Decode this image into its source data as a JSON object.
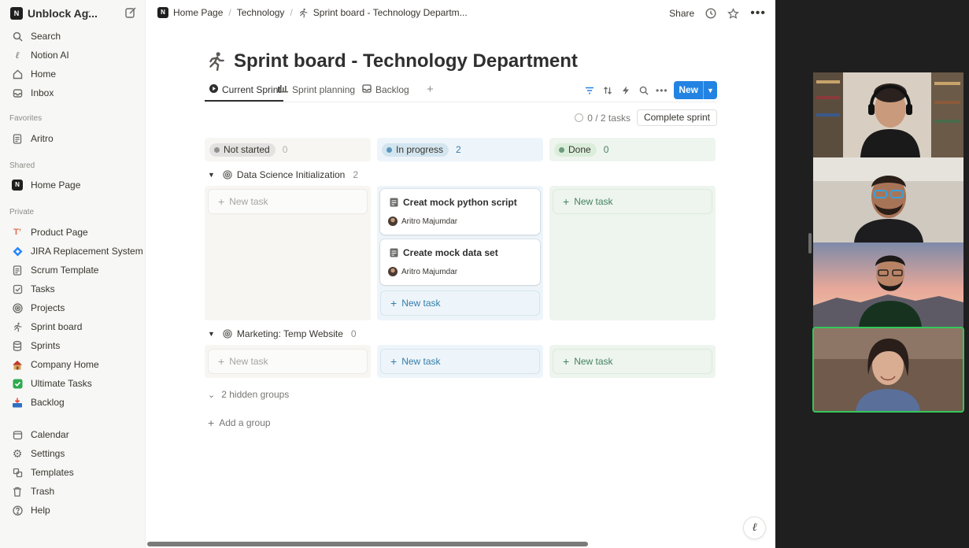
{
  "sidebar": {
    "workspace_name": "Unblock Ag...",
    "top_items": [
      {
        "label": "Search",
        "icon": "search-icon"
      },
      {
        "label": "Notion AI",
        "icon": "notion-ai-icon"
      },
      {
        "label": "Home",
        "icon": "home-icon"
      },
      {
        "label": "Inbox",
        "icon": "inbox-icon"
      }
    ],
    "favorites_label": "Favorites",
    "favorites": [
      {
        "label": "Aritro",
        "icon": "page-icon"
      }
    ],
    "shared_label": "Shared",
    "shared": [
      {
        "label": "Home Page",
        "icon": "notion-logo-icon"
      }
    ],
    "private_label": "Private",
    "private": [
      {
        "label": "Product Page",
        "icon": "product-page-icon"
      },
      {
        "label": "JIRA Replacement System",
        "icon": "jira-icon"
      },
      {
        "label": "Scrum Template",
        "icon": "page-icon"
      },
      {
        "label": "Tasks",
        "icon": "checkbox-icon"
      },
      {
        "label": "Projects",
        "icon": "target-icon"
      },
      {
        "label": "Sprint board",
        "icon": "runner-icon"
      },
      {
        "label": "Sprints",
        "icon": "database-icon"
      },
      {
        "label": "Company Home",
        "icon": "house-emoji-icon"
      },
      {
        "label": "Ultimate Tasks",
        "icon": "green-check-icon"
      },
      {
        "label": "Backlog",
        "icon": "inbox-tray-icon"
      }
    ],
    "bottom_items": [
      {
        "label": "Calendar",
        "icon": "calendar-icon"
      },
      {
        "label": "Settings",
        "icon": "gear-icon"
      },
      {
        "label": "Templates",
        "icon": "templates-icon"
      },
      {
        "label": "Trash",
        "icon": "trash-icon"
      },
      {
        "label": "Help",
        "icon": "help-icon"
      }
    ]
  },
  "topbar": {
    "breadcrumbs": [
      "Home Page",
      "Technology",
      "Sprint board - Technology Departm..."
    ],
    "share_label": "Share"
  },
  "page": {
    "title": "Sprint board - Technology Department",
    "tabs": [
      {
        "label": "Current Sprint",
        "icon": "play-icon"
      },
      {
        "label": "Sprint planning",
        "icon": "timeline-icon"
      },
      {
        "label": "Backlog",
        "icon": "inbox-tray-icon"
      }
    ],
    "new_label": "New",
    "progress_text": "0 / 2 tasks",
    "complete_sprint_label": "Complete sprint",
    "columns": [
      {
        "label": "Not started",
        "count": "0",
        "pill_bg": "#e3e2e0",
        "dot": "#91918e",
        "head_bg": "#f7f6f3",
        "count_color": "#b4b3af"
      },
      {
        "label": "In progress",
        "count": "2",
        "pill_bg": "#d3e5ef",
        "dot": "#5b97bd",
        "head_bg": "#eef5fa",
        "count_color": "#337ea9"
      },
      {
        "label": "Done",
        "count": "0",
        "pill_bg": "#dbeddb",
        "dot": "#6c9b7d",
        "head_bg": "#eef4ee",
        "count_color": "#448361"
      }
    ],
    "new_task_label": "New task",
    "groups": [
      {
        "name": "Data Science Initialization",
        "count": "2",
        "tasks": [
          {
            "title": "Creat mock python script",
            "assignee": "Aritro Majumdar"
          },
          {
            "title": "Create mock data set",
            "assignee": "Aritro Majumdar"
          }
        ]
      },
      {
        "name": "Marketing: Temp Website",
        "count": "0",
        "tasks": []
      }
    ],
    "hidden_groups_label": "2 hidden groups",
    "add_group_label": "Add a group"
  },
  "colors": {
    "accent": "#2383e2",
    "speaking": "#34c759"
  }
}
